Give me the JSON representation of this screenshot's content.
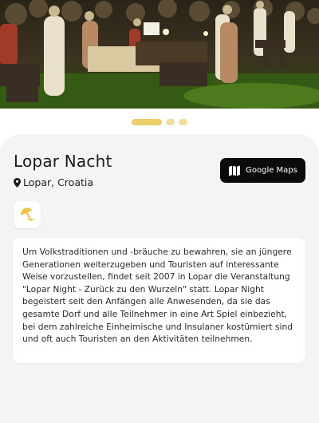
{
  "hero": {
    "image_description": "evening village festival crowd in traditional dress",
    "image_label": "Lopar Nacht festival photo"
  },
  "gallery": {
    "pages": 3,
    "active_index": 0
  },
  "event": {
    "title": "Lopar Nacht",
    "location": "Lopar, Croatia",
    "location_icon": "map-pin-icon",
    "category_icon": "umbrella-beach-icon",
    "description": "Um Volkstraditionen und -bräuche zu bewahren, sie an jüngere Generationen weiterzugeben und Touristen auf interessante Weise vorzustellen, findet seit 2007 in Lopar die Veranstaltung \"Lopar Night - Zurück zu den Wurzeln\" statt. Lopar Night begeistert seit den Anfängen alle Anwesenden, da sie das gesamte Dorf und alle Teilnehmer in eine Art Spiel einbezieht, bei dem zahlreiche Einheimische und Insulaner kostümiert sind und oft auch Touristen an den Aktivitäten teilnehmen."
  },
  "maps_button": {
    "label": "Google Maps",
    "icon": "map-icon"
  },
  "colors": {
    "accent": "#edcf6a",
    "button": "#0b0b0b",
    "card": "#f4f4f4"
  }
}
